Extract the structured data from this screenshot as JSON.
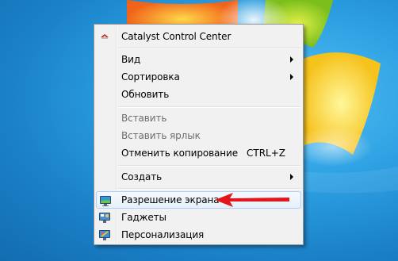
{
  "menu": {
    "items": [
      {
        "label": "Catalyst Control Center",
        "icon": "ati-logo-icon",
        "enabled": true
      },
      {
        "label": "Вид",
        "submenu": true,
        "enabled": true
      },
      {
        "label": "Сортировка",
        "submenu": true,
        "enabled": true
      },
      {
        "label": "Обновить",
        "enabled": true
      },
      {
        "label": "Вставить",
        "enabled": false
      },
      {
        "label": "Вставить ярлык",
        "enabled": false
      },
      {
        "label": "Отменить копирование",
        "shortcut": "CTRL+Z",
        "enabled": true
      },
      {
        "label": "Создать",
        "submenu": true,
        "enabled": true
      },
      {
        "label": "Разрешение экрана",
        "icon": "display-icon",
        "enabled": true,
        "highlighted": true
      },
      {
        "label": "Гаджеты",
        "icon": "gadgets-icon",
        "enabled": true
      },
      {
        "label": "Персонализация",
        "icon": "personalization-icon",
        "enabled": true
      }
    ]
  },
  "annotation": {
    "arrow_color": "#e3161c",
    "points_to": "Разрешение экрана"
  },
  "colors": {
    "desktop_blue": "#1d87cf",
    "menu_background": "#f1f1f1",
    "highlight_border": "#aecff7"
  }
}
